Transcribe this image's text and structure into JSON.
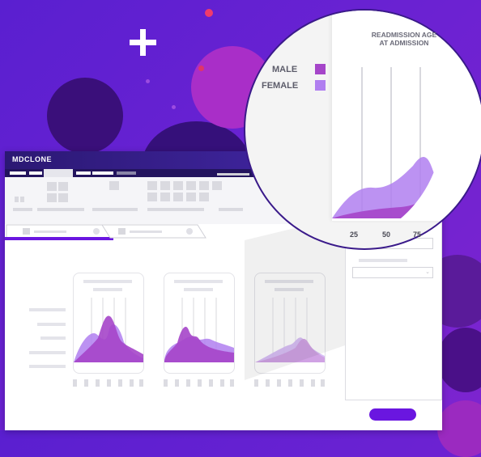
{
  "app": {
    "brand": "MDCLONE"
  },
  "zoom": {
    "title_line1": "READMISSION AGE",
    "title_line2": "AT ADMISSION",
    "legend": [
      {
        "label": "MALE",
        "color": "#a545c9"
      },
      {
        "label": "FEMALE",
        "color": "#b07ff0"
      }
    ],
    "x_ticks": [
      "25",
      "50",
      "75"
    ]
  },
  "chart_data": {
    "type": "area",
    "title": "READMISSION AGE AT ADMISSION",
    "x_ticks": [
      25,
      50,
      75
    ],
    "series": [
      {
        "name": "MALE"
      },
      {
        "name": "FEMALE"
      }
    ]
  },
  "colors": {
    "accent": "#6a16e0",
    "brand_bar": "#2b1873",
    "male": "#a545c9",
    "female": "#b07ff0"
  }
}
